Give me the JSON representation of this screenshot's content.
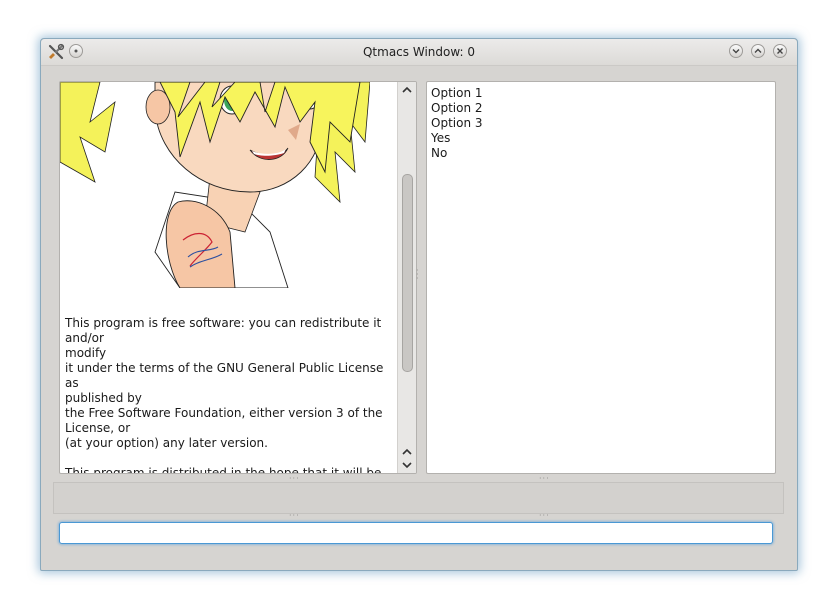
{
  "window": {
    "title": "Qtmacs Window: 0"
  },
  "license_text": "This program is free software: you can redistribute it and/or\nmodify\nit under the terms of the GNU General Public License as\npublished by\nthe Free Software Foundation, either version 3 of the\nLicense, or\n(at your option) any later version.\n\nThis program is distributed in the hope that it will be useful,\nbut WITHOUT ANY WARRANTY; without even the implied\nwarranty of",
  "options": [
    "Option 1",
    "Option 2",
    "Option 3",
    "Yes",
    "No"
  ],
  "command_input": {
    "value": "",
    "placeholder": ""
  },
  "icons": {
    "app": "tools-icon",
    "menu": "window-menu-icon",
    "minimize": "minimize-icon",
    "maximize": "maximize-icon",
    "close": "close-icon",
    "scroll_up": "arrow-up-icon",
    "scroll_down": "arrow-down-icon"
  }
}
